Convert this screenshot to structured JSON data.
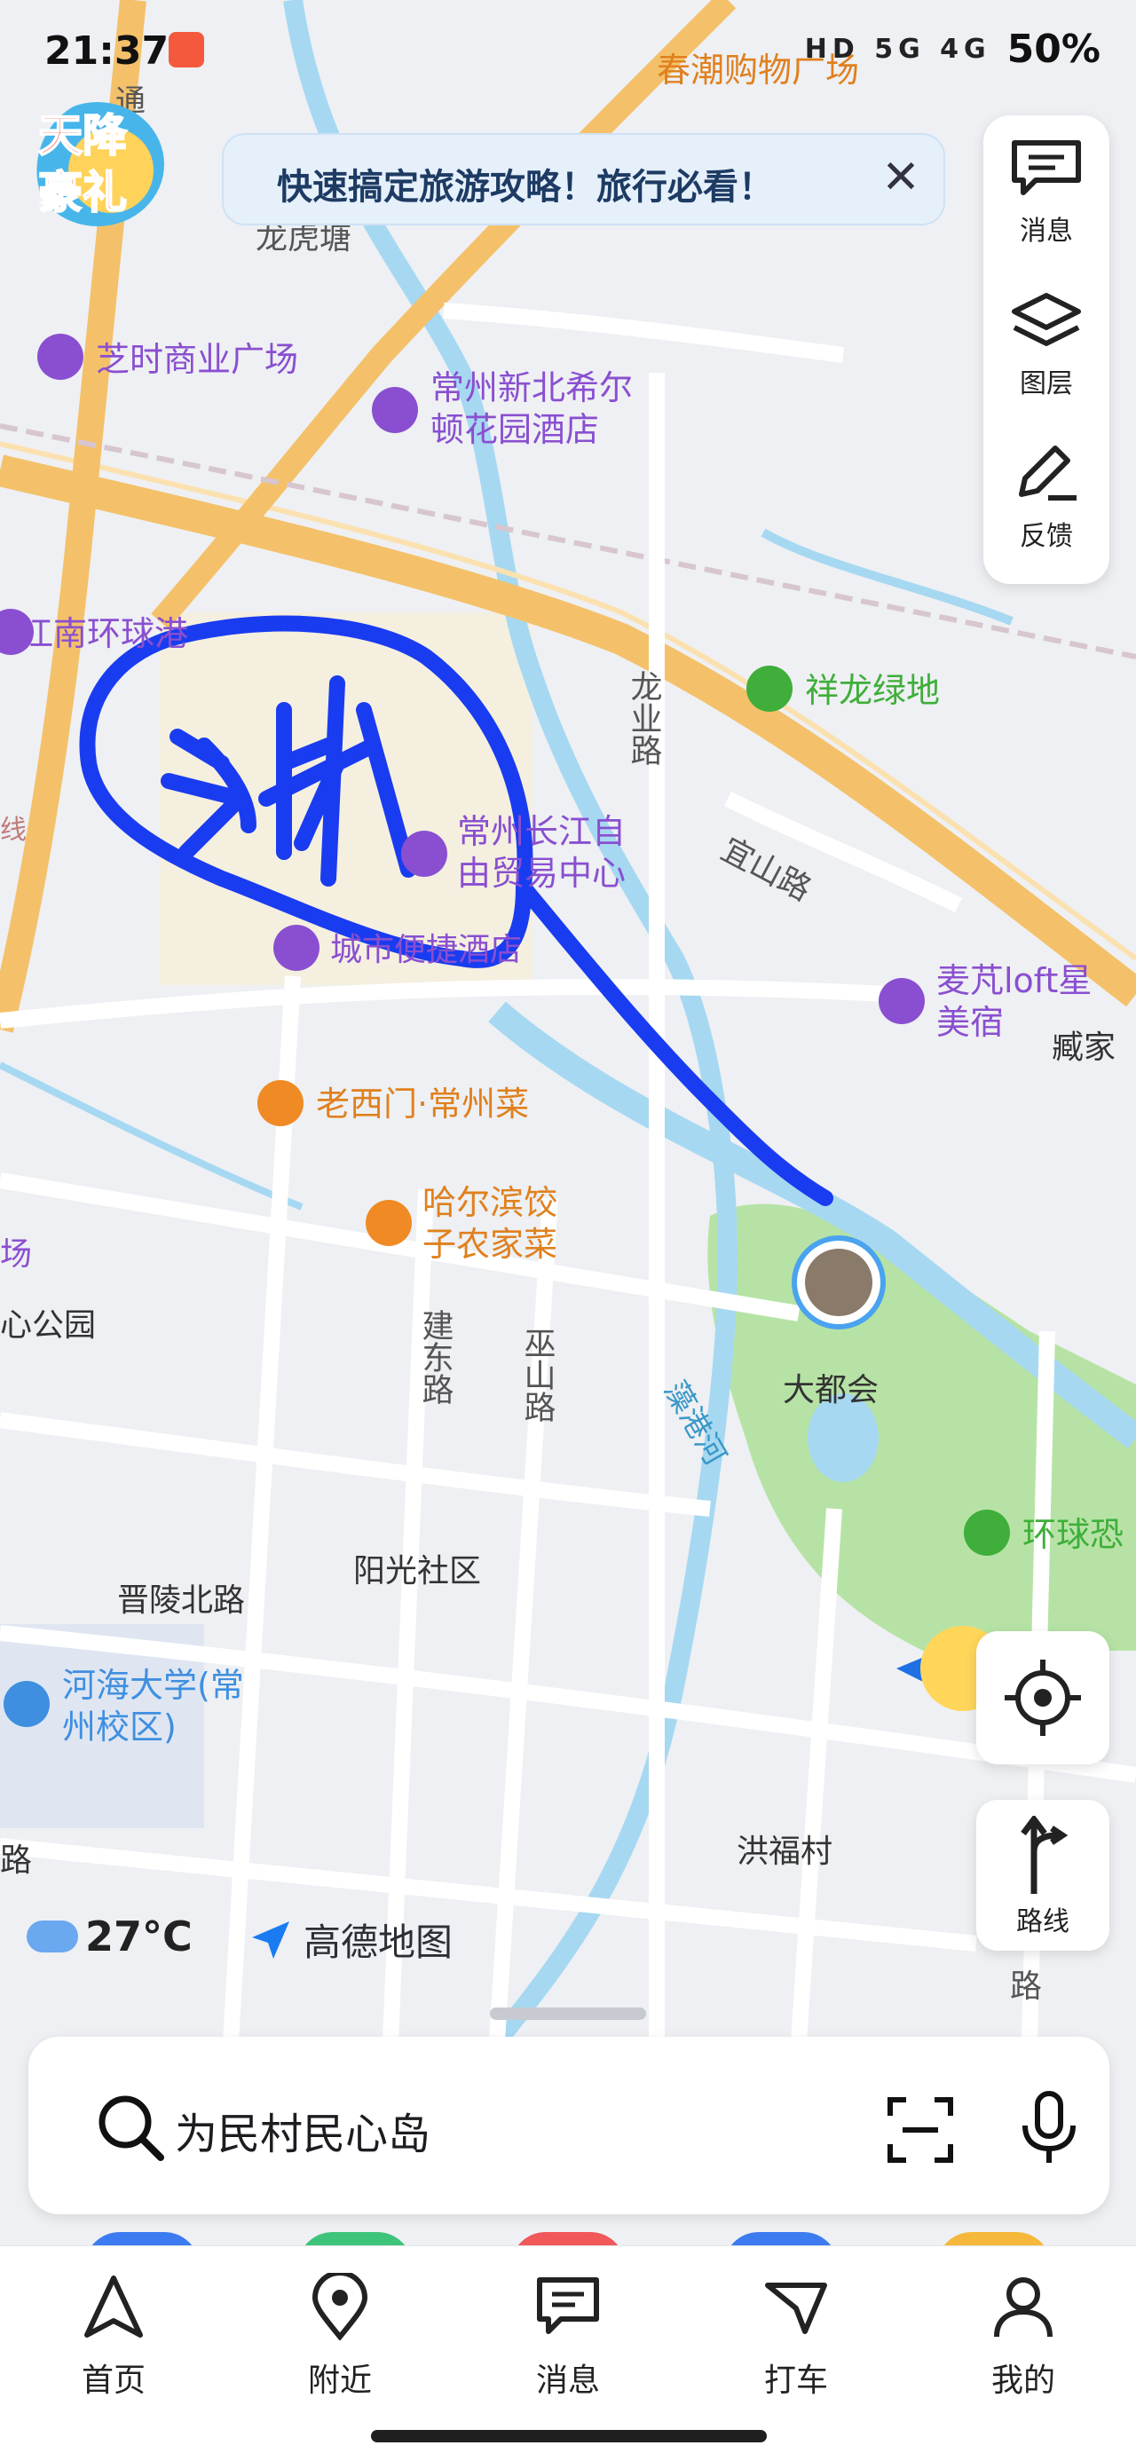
{
  "status_bar": {
    "time": "21:37",
    "battery": "50%",
    "network_icons": "HD 5G 4G"
  },
  "banner_badge": {
    "line1": "天降",
    "line2": "豪礼"
  },
  "promo": {
    "text": "快速搞定旅游攻略！旅行必看！",
    "close_icon": "close-icon"
  },
  "side_panel": {
    "items": [
      {
        "label": "消息",
        "icon": "message-icon"
      },
      {
        "label": "图层",
        "icon": "layers-icon"
      },
      {
        "label": "反馈",
        "icon": "feedback-icon"
      }
    ]
  },
  "locate_button": {
    "icon": "locate-icon"
  },
  "route_button": {
    "label": "路线",
    "icon": "route-icon"
  },
  "map_labels": {
    "chunchao": "春潮购物广场",
    "longhutang": "龙虎塘",
    "zhishi": "芝时商业广场",
    "hilton1": "常州新北希尔",
    "hilton2": "顿花园酒店",
    "jiangnan": "江南环球港",
    "xianglong": "祥龙绿地",
    "longye_road": "龙业路",
    "changjiang1": "常州长江自",
    "changjiang2": "由贸易中心",
    "yishan_road": "宜山路",
    "hotel_partial": "城市便捷酒店",
    "maipeng1": "麦芃loft星",
    "maipeng2": "美宿",
    "zangjia": "臧家",
    "laoximen": "老西门·常州菜",
    "haerbin1": "哈尔滨饺",
    "haerbin2": "子农家菜",
    "park": "心公园",
    "jiandong_road": "建东路",
    "wushan_road": "巫山路",
    "daduhui": "大都会",
    "zaogang_river": "藻港河",
    "huanqiu": "环球恐",
    "yangguang": "阳光社区",
    "jinling_road": "晋陵北路",
    "hohai1": "河海大学(常",
    "hohai2": "州校区)",
    "hongfu": "洪福村",
    "road_edge": "路",
    "lu_left": "路",
    "chang_left": "场",
    "xian_left": "线",
    "tong": "通",
    "handwriting": "湖"
  },
  "weather": {
    "temperature": "27°C",
    "icon": "cloud-icon"
  },
  "brand": {
    "name": "高德地图",
    "icon": "amap-logo-icon"
  },
  "search": {
    "value": "为民村民心岛",
    "search_icon": "search-icon",
    "scan_icon": "scan-icon",
    "mic_icon": "microphone-icon"
  },
  "tabs": [
    {
      "label": "首页",
      "icon": "navigation-arrow-icon"
    },
    {
      "label": "附近",
      "icon": "location-pin-icon"
    },
    {
      "label": "消息",
      "icon": "chat-icon"
    },
    {
      "label": "打车",
      "icon": "taxi-icon"
    },
    {
      "label": "我的",
      "icon": "user-icon"
    }
  ],
  "colors": {
    "road_major": "#f4c16a",
    "road_minor": "#ffffff",
    "water": "#a6d8f2",
    "green": "#b6e3a5",
    "drawing": "#1a3cf0",
    "poi_purple": "#8a4fd0",
    "poi_orange": "#f08a24",
    "poi_green": "#3fae3a"
  }
}
